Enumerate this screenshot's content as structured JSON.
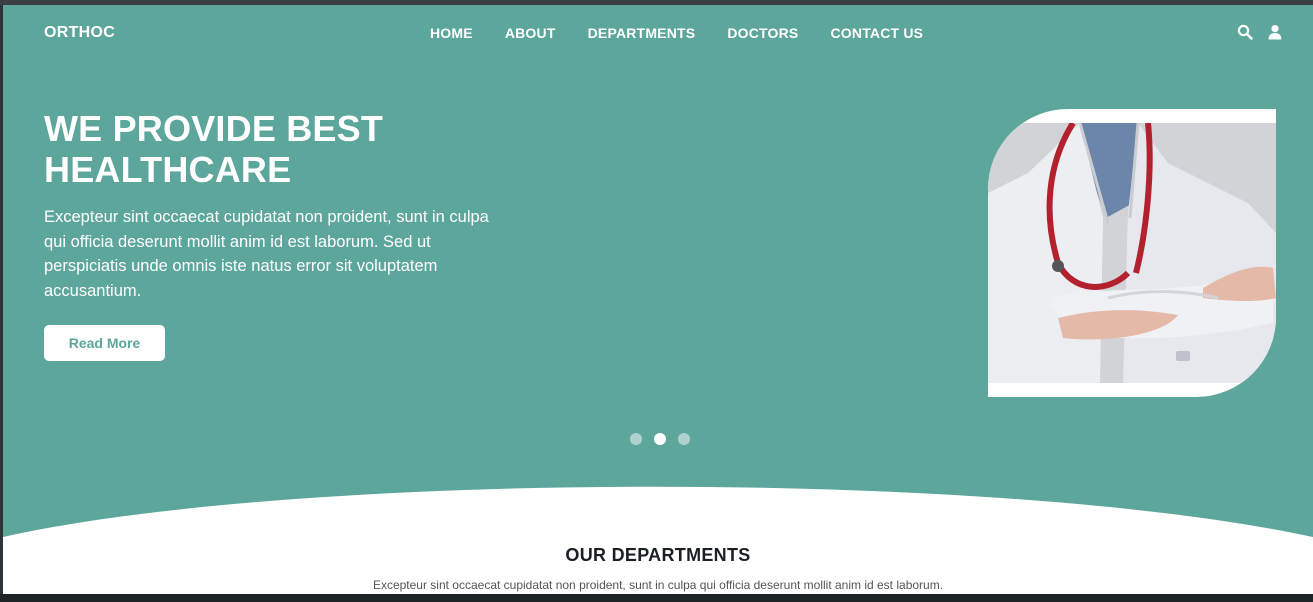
{
  "header": {
    "logo": "ORTHOC",
    "nav": [
      "HOME",
      "ABOUT",
      "DEPARTMENTS",
      "DOCTORS",
      "CONTACT US"
    ],
    "icons": [
      "search-icon",
      "user-icon"
    ]
  },
  "hero": {
    "title": "WE PROVIDE BEST HEALTHCARE",
    "text": "Excepteur sint occaecat cupidatat non proident, sunt in culpa qui officia deserunt mollit anim id est laborum. Sed ut perspiciatis unde omnis iste natus error sit voluptatem accusantium.",
    "button": "Read More",
    "slides": 3,
    "active_slide": 2
  },
  "departments": {
    "title": "OUR DEPARTMENTS",
    "subtitle": "Excepteur sint occaecat cupidatat non proident, sunt in culpa qui officia deserunt mollit anim id est laborum."
  },
  "colors": {
    "primary": "#5da69b",
    "text_dark": "#1a1f23",
    "white": "#ffffff"
  }
}
